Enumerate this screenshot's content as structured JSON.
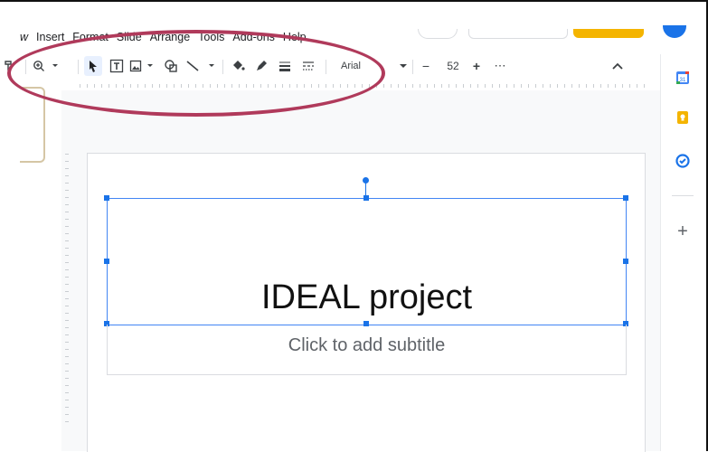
{
  "menu": {
    "items": [
      {
        "label": "w"
      },
      {
        "label": "Insert"
      },
      {
        "label": "Format"
      },
      {
        "label": "Slide"
      },
      {
        "label": "Arrange"
      },
      {
        "label": "Tools"
      },
      {
        "label": "Add-ons"
      },
      {
        "label": "Help"
      }
    ]
  },
  "toolbar": {
    "font_name": "Arial",
    "font_size": "52",
    "decrease_label": "−",
    "increase_label": "+",
    "more_label": "⋯",
    "collapse_label": "^"
  },
  "slide": {
    "title": "IDEAL project",
    "subtitle": "Click to add subtitle"
  },
  "side_panel": {
    "calendar_day": "31",
    "add_label": "+"
  },
  "colors": {
    "selection": "#1a73e8",
    "annotation": "#b03a5b",
    "accent_yellow": "#f4b400"
  }
}
